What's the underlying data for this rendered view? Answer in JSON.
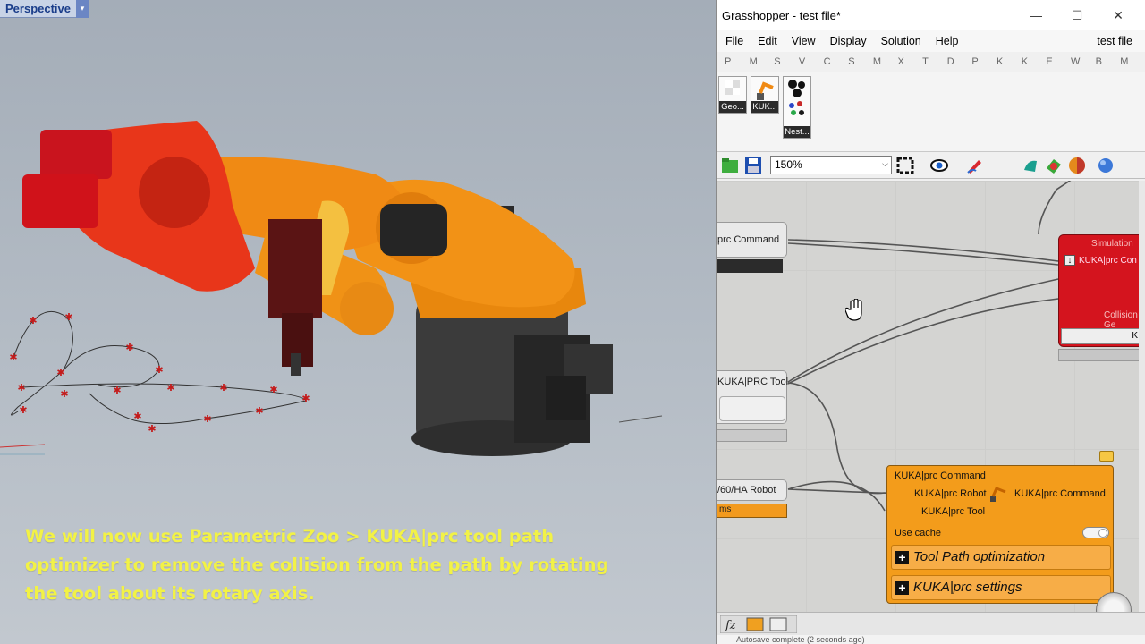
{
  "viewport": {
    "title": "Perspective",
    "dropdown_glyph": "▾",
    "caption": "We will now use Parametric Zoo > KUKA|prc tool path optimizer to remove the collision from the path by rotating the tool about its rotary axis."
  },
  "grasshopper": {
    "window_title": "Grasshopper - test file*",
    "window_controls": {
      "minimize": "—",
      "maximize": "☐",
      "close": "✕"
    },
    "menu": [
      "File",
      "Edit",
      "View",
      "Display",
      "Solution",
      "Help"
    ],
    "file_name": "test file",
    "tabs": [
      "P",
      "M",
      "S",
      "V",
      "C",
      "S",
      "M",
      "X",
      "T",
      "D",
      "P",
      "K",
      "K",
      "E",
      "W",
      "B",
      "M"
    ],
    "ribbon": [
      {
        "label": "Geo...",
        "icon": "checker-icon"
      },
      {
        "label": "KUK...",
        "icon": "robot-arm-icon"
      },
      {
        "label": "Nest...",
        "icon": "nest-icon"
      }
    ],
    "zoom": "150%",
    "zoom_arrow": "⌵",
    "canvas": {
      "components": {
        "command_param": "prc Command",
        "tool_param": "KUKA|PRC Tool",
        "robot_param": "/60/HA Robot",
        "robot_sub": "ms",
        "red_comp": {
          "in1": "Simulation",
          "in2": "KUKA|prc Con",
          "in3": "Collision Ge",
          "btn": "K"
        },
        "orange_comp": {
          "in_command": "KUKA|prc Command",
          "in_robot": "KUKA|prc Robot",
          "in_tool": "KUKA|prc Tool",
          "out_command": "KUKA|prc Command",
          "use_cache": "Use cache",
          "section1": "Tool Path optimization",
          "section2": "KUKA|prc settings",
          "plus": "+"
        }
      }
    },
    "status": "Autosave complete (2 seconds ago)"
  }
}
